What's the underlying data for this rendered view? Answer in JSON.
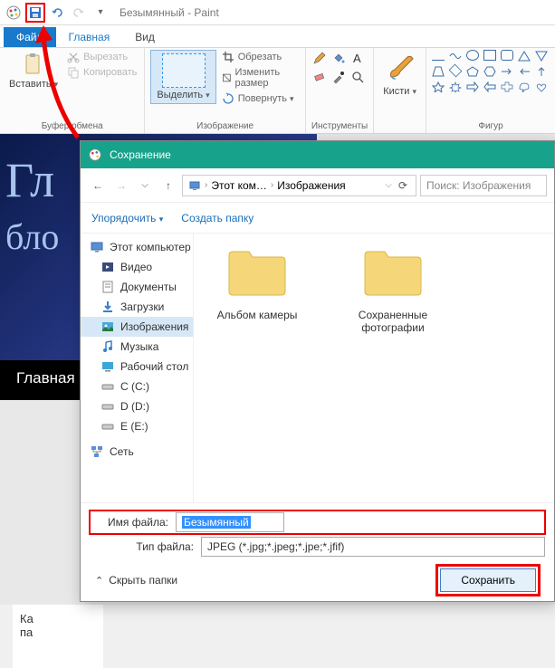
{
  "titlebar": {
    "doc_name": "Безымянный",
    "app_name": "Paint"
  },
  "tabs": {
    "file": "Файл",
    "home": "Главная",
    "view": "Вид"
  },
  "ribbon": {
    "clipboard": {
      "paste": "Вставить",
      "cut": "Вырезать",
      "copy": "Копировать",
      "group": "Буфер обмена"
    },
    "image": {
      "select": "Выделить",
      "crop": "Обрезать",
      "resize": "Изменить размер",
      "rotate": "Повернуть",
      "group": "Изображение"
    },
    "tools": {
      "group": "Инструменты"
    },
    "brushes": {
      "label": "Кисти"
    },
    "shapes": {
      "group": "Фигур"
    }
  },
  "canvas": {
    "text1": "Гл",
    "text2": "бло",
    "menu": "Главная",
    "card_l1": "Ка",
    "card_l2": "па"
  },
  "dialog": {
    "title": "Сохранение",
    "breadcrumb": {
      "pc": "Этот ком…",
      "folder": "Изображения"
    },
    "search_placeholder": "Поиск: Изображения",
    "organize": "Упорядочить",
    "new_folder": "Создать папку",
    "tree": {
      "this_pc": "Этот компьютер",
      "videos": "Видео",
      "documents": "Документы",
      "downloads": "Загрузки",
      "pictures": "Изображения",
      "music": "Музыка",
      "desktop": "Рабочий стол",
      "disk_c": "C (С:)",
      "disk_d": "D (D:)",
      "disk_e": "E (E:)",
      "network": "Сеть"
    },
    "folders": {
      "camera": "Альбом камеры",
      "saved": "Сохраненные фотографии"
    },
    "filename_label": "Имя файла:",
    "filename_value": "Безымянный",
    "filetype_label": "Тип файла:",
    "filetype_value": "JPEG (*.jpg;*.jpeg;*.jpe;*.jfif)",
    "hide_folders": "Скрыть папки",
    "save_btn": "Сохранить"
  }
}
